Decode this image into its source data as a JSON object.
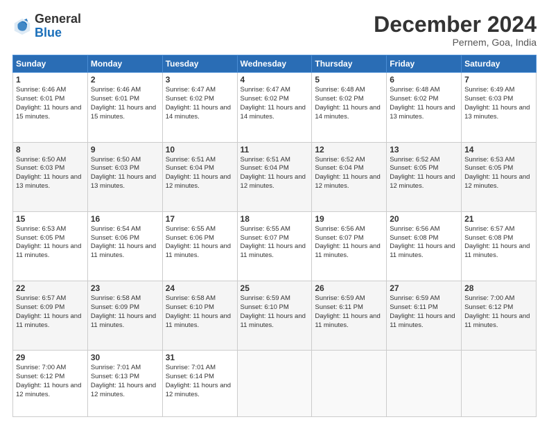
{
  "header": {
    "logo_general": "General",
    "logo_blue": "Blue",
    "title": "December 2024",
    "location": "Pernem, Goa, India"
  },
  "days_of_week": [
    "Sunday",
    "Monday",
    "Tuesday",
    "Wednesday",
    "Thursday",
    "Friday",
    "Saturday"
  ],
  "weeks": [
    [
      {
        "day": "1",
        "sunrise": "Sunrise: 6:46 AM",
        "sunset": "Sunset: 6:01 PM",
        "daylight": "Daylight: 11 hours and 15 minutes."
      },
      {
        "day": "2",
        "sunrise": "Sunrise: 6:46 AM",
        "sunset": "Sunset: 6:01 PM",
        "daylight": "Daylight: 11 hours and 15 minutes."
      },
      {
        "day": "3",
        "sunrise": "Sunrise: 6:47 AM",
        "sunset": "Sunset: 6:02 PM",
        "daylight": "Daylight: 11 hours and 14 minutes."
      },
      {
        "day": "4",
        "sunrise": "Sunrise: 6:47 AM",
        "sunset": "Sunset: 6:02 PM",
        "daylight": "Daylight: 11 hours and 14 minutes."
      },
      {
        "day": "5",
        "sunrise": "Sunrise: 6:48 AM",
        "sunset": "Sunset: 6:02 PM",
        "daylight": "Daylight: 11 hours and 14 minutes."
      },
      {
        "day": "6",
        "sunrise": "Sunrise: 6:48 AM",
        "sunset": "Sunset: 6:02 PM",
        "daylight": "Daylight: 11 hours and 13 minutes."
      },
      {
        "day": "7",
        "sunrise": "Sunrise: 6:49 AM",
        "sunset": "Sunset: 6:03 PM",
        "daylight": "Daylight: 11 hours and 13 minutes."
      }
    ],
    [
      {
        "day": "8",
        "sunrise": "Sunrise: 6:50 AM",
        "sunset": "Sunset: 6:03 PM",
        "daylight": "Daylight: 11 hours and 13 minutes."
      },
      {
        "day": "9",
        "sunrise": "Sunrise: 6:50 AM",
        "sunset": "Sunset: 6:03 PM",
        "daylight": "Daylight: 11 hours and 13 minutes."
      },
      {
        "day": "10",
        "sunrise": "Sunrise: 6:51 AM",
        "sunset": "Sunset: 6:04 PM",
        "daylight": "Daylight: 11 hours and 12 minutes."
      },
      {
        "day": "11",
        "sunrise": "Sunrise: 6:51 AM",
        "sunset": "Sunset: 6:04 PM",
        "daylight": "Daylight: 11 hours and 12 minutes."
      },
      {
        "day": "12",
        "sunrise": "Sunrise: 6:52 AM",
        "sunset": "Sunset: 6:04 PM",
        "daylight": "Daylight: 11 hours and 12 minutes."
      },
      {
        "day": "13",
        "sunrise": "Sunrise: 6:52 AM",
        "sunset": "Sunset: 6:05 PM",
        "daylight": "Daylight: 11 hours and 12 minutes."
      },
      {
        "day": "14",
        "sunrise": "Sunrise: 6:53 AM",
        "sunset": "Sunset: 6:05 PM",
        "daylight": "Daylight: 11 hours and 12 minutes."
      }
    ],
    [
      {
        "day": "15",
        "sunrise": "Sunrise: 6:53 AM",
        "sunset": "Sunset: 6:05 PM",
        "daylight": "Daylight: 11 hours and 11 minutes."
      },
      {
        "day": "16",
        "sunrise": "Sunrise: 6:54 AM",
        "sunset": "Sunset: 6:06 PM",
        "daylight": "Daylight: 11 hours and 11 minutes."
      },
      {
        "day": "17",
        "sunrise": "Sunrise: 6:55 AM",
        "sunset": "Sunset: 6:06 PM",
        "daylight": "Daylight: 11 hours and 11 minutes."
      },
      {
        "day": "18",
        "sunrise": "Sunrise: 6:55 AM",
        "sunset": "Sunset: 6:07 PM",
        "daylight": "Daylight: 11 hours and 11 minutes."
      },
      {
        "day": "19",
        "sunrise": "Sunrise: 6:56 AM",
        "sunset": "Sunset: 6:07 PM",
        "daylight": "Daylight: 11 hours and 11 minutes."
      },
      {
        "day": "20",
        "sunrise": "Sunrise: 6:56 AM",
        "sunset": "Sunset: 6:08 PM",
        "daylight": "Daylight: 11 hours and 11 minutes."
      },
      {
        "day": "21",
        "sunrise": "Sunrise: 6:57 AM",
        "sunset": "Sunset: 6:08 PM",
        "daylight": "Daylight: 11 hours and 11 minutes."
      }
    ],
    [
      {
        "day": "22",
        "sunrise": "Sunrise: 6:57 AM",
        "sunset": "Sunset: 6:09 PM",
        "daylight": "Daylight: 11 hours and 11 minutes."
      },
      {
        "day": "23",
        "sunrise": "Sunrise: 6:58 AM",
        "sunset": "Sunset: 6:09 PM",
        "daylight": "Daylight: 11 hours and 11 minutes."
      },
      {
        "day": "24",
        "sunrise": "Sunrise: 6:58 AM",
        "sunset": "Sunset: 6:10 PM",
        "daylight": "Daylight: 11 hours and 11 minutes."
      },
      {
        "day": "25",
        "sunrise": "Sunrise: 6:59 AM",
        "sunset": "Sunset: 6:10 PM",
        "daylight": "Daylight: 11 hours and 11 minutes."
      },
      {
        "day": "26",
        "sunrise": "Sunrise: 6:59 AM",
        "sunset": "Sunset: 6:11 PM",
        "daylight": "Daylight: 11 hours and 11 minutes."
      },
      {
        "day": "27",
        "sunrise": "Sunrise: 6:59 AM",
        "sunset": "Sunset: 6:11 PM",
        "daylight": "Daylight: 11 hours and 11 minutes."
      },
      {
        "day": "28",
        "sunrise": "Sunrise: 7:00 AM",
        "sunset": "Sunset: 6:12 PM",
        "daylight": "Daylight: 11 hours and 11 minutes."
      }
    ],
    [
      {
        "day": "29",
        "sunrise": "Sunrise: 7:00 AM",
        "sunset": "Sunset: 6:12 PM",
        "daylight": "Daylight: 11 hours and 12 minutes."
      },
      {
        "day": "30",
        "sunrise": "Sunrise: 7:01 AM",
        "sunset": "Sunset: 6:13 PM",
        "daylight": "Daylight: 11 hours and 12 minutes."
      },
      {
        "day": "31",
        "sunrise": "Sunrise: 7:01 AM",
        "sunset": "Sunset: 6:14 PM",
        "daylight": "Daylight: 11 hours and 12 minutes."
      },
      null,
      null,
      null,
      null
    ]
  ]
}
